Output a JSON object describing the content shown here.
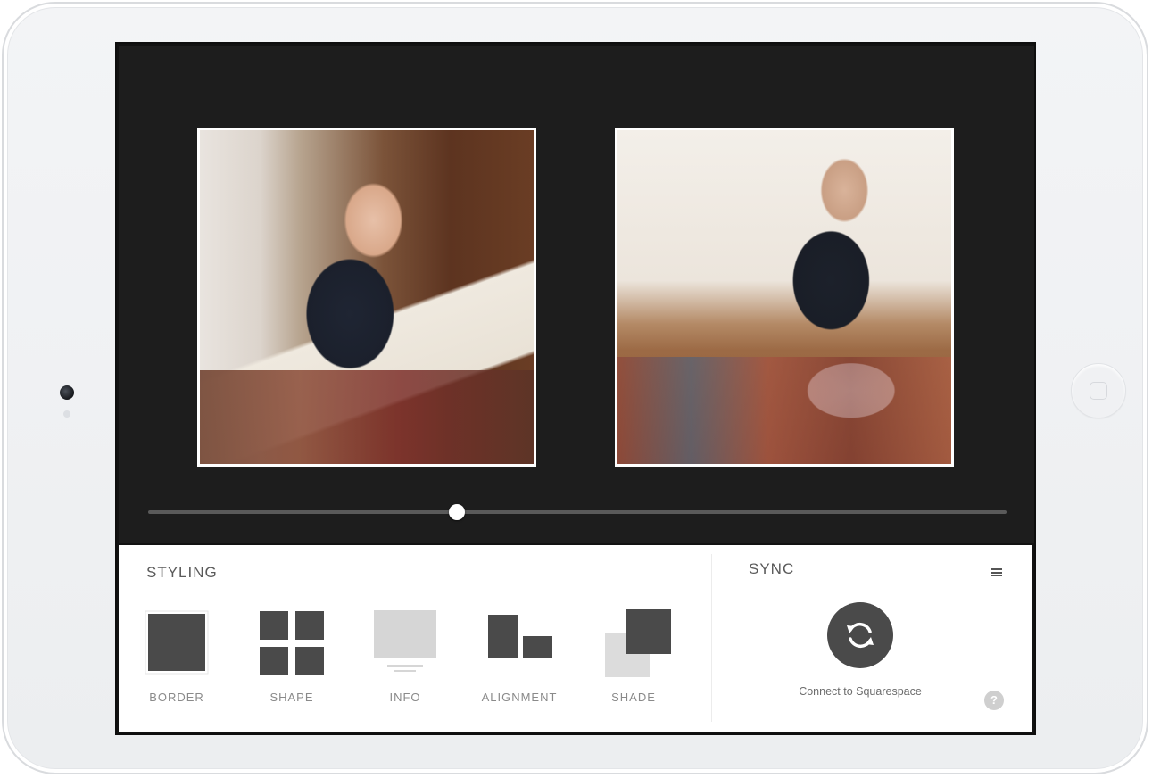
{
  "styling": {
    "title": "STYLING",
    "tools": [
      {
        "label": "BORDER",
        "icon": "border-icon",
        "selected": true
      },
      {
        "label": "SHAPE",
        "icon": "shape-grid-icon",
        "selected": false
      },
      {
        "label": "INFO",
        "icon": "info-caption-icon",
        "selected": false
      },
      {
        "label": "ALIGNMENT",
        "icon": "alignment-icon",
        "selected": false
      },
      {
        "label": "SHADE",
        "icon": "shade-icon",
        "selected": false
      }
    ]
  },
  "sync": {
    "title": "SYNC",
    "connect_label": "Connect to Squarespace",
    "menu_icon": "menu-icon",
    "sync_icon": "sync-arrows-icon",
    "help_symbol": "?"
  },
  "canvas": {
    "photos": [
      "photo-woman-with-papers",
      "photo-woman-with-drawings"
    ],
    "slider_value": 0.36
  },
  "colors": {
    "canvas_bg": "#1d1d1d",
    "panel_bg": "#ffffff",
    "icon_dark": "#4a4a4a",
    "icon_light": "#dcdcdc",
    "label_gray": "#8a8a8a"
  }
}
